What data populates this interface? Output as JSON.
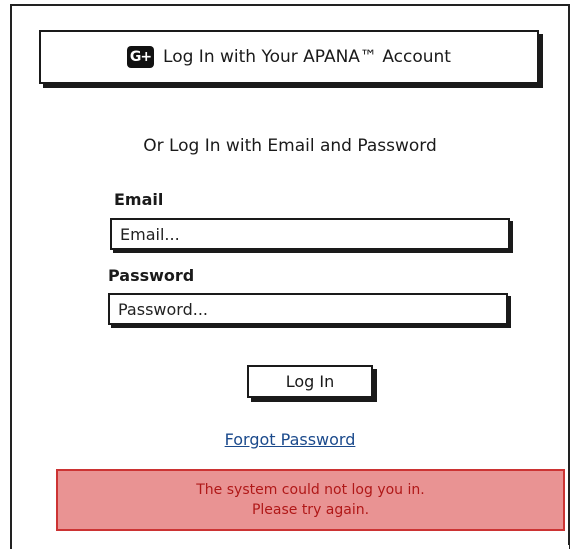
{
  "oauth_button": {
    "logo_text": "G+",
    "label": "Log In with Your APANA™ Account"
  },
  "divider_text": "Or Log In with Email and Password",
  "email": {
    "label": "Email",
    "placeholder": "Email..."
  },
  "password": {
    "label": "Password",
    "placeholder": "Password..."
  },
  "login_button": {
    "label": "Log In"
  },
  "forgot_link": {
    "label": "Forgot Password"
  },
  "error": {
    "line1": "The system could not log you in.",
    "line2": "Please try again."
  },
  "colors": {
    "link": "#1b4a8c",
    "error_bg": "#e99393",
    "error_border": "#cc3333",
    "error_text": "#b01818"
  }
}
